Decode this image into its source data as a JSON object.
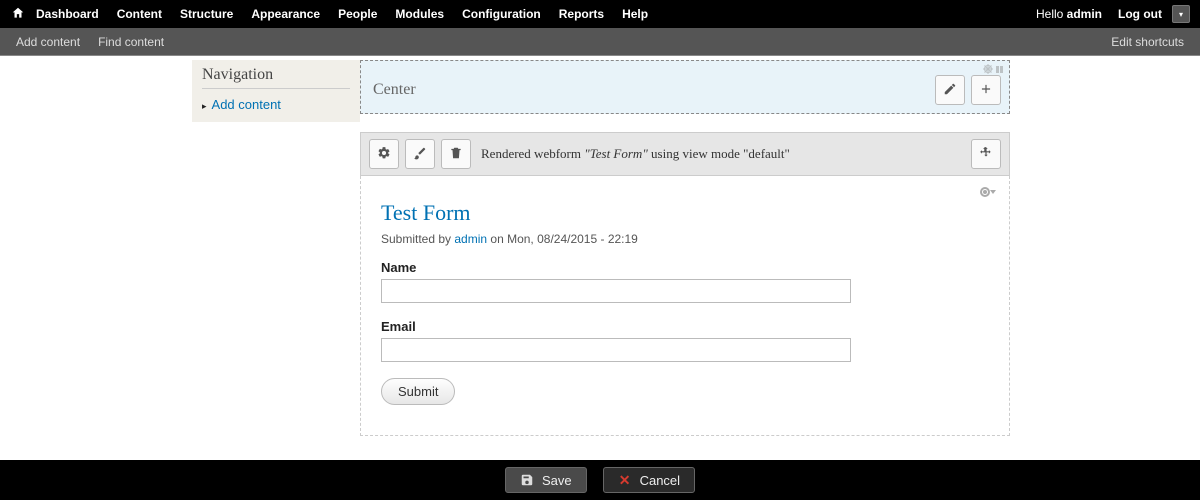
{
  "adminbar": {
    "menu": [
      "Dashboard",
      "Content",
      "Structure",
      "Appearance",
      "People",
      "Modules",
      "Configuration",
      "Reports",
      "Help"
    ],
    "hello_prefix": "Hello ",
    "hello_user": "admin",
    "logout": "Log out"
  },
  "shortcutbar": {
    "items": [
      "Add content",
      "Find content"
    ],
    "edit": "Edit shortcuts"
  },
  "sidebar": {
    "nav_title": "Navigation",
    "nav_link": "Add content"
  },
  "region": {
    "label": "Center"
  },
  "component": {
    "desc_prefix": "Rendered webform ",
    "desc_name": "\"Test Form\"",
    "desc_suffix": " using view mode \"default\""
  },
  "form": {
    "title": "Test Form",
    "meta_prefix": "Submitted by ",
    "meta_author": "admin",
    "meta_suffix": " on Mon, 08/24/2015 - 22:19",
    "name_label": "Name",
    "email_label": "Email",
    "submit": "Submit"
  },
  "bottombar": {
    "save": "Save",
    "cancel": "Cancel"
  }
}
